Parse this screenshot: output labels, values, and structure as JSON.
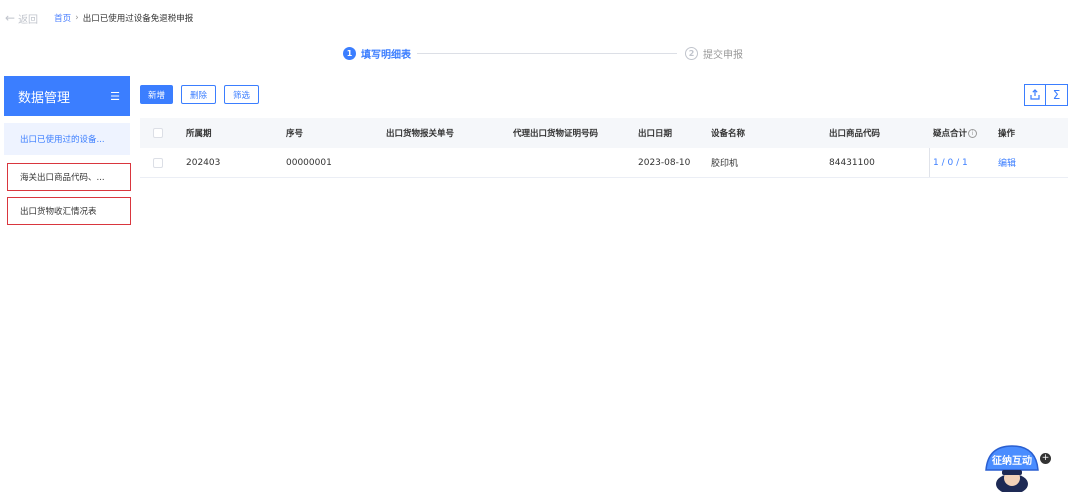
{
  "nav": {
    "back_label": "返回",
    "crumb_home": "首页",
    "crumb_sep": "›",
    "crumb_current": "出口已使用过设备免退税申报"
  },
  "steps": [
    {
      "num": "1",
      "label": "填写明细表",
      "active": true
    },
    {
      "num": "2",
      "label": "提交申报",
      "active": false
    }
  ],
  "sidebar": {
    "title": "数据管理",
    "toggle_icon": "menu-collapse-icon",
    "items": [
      {
        "label": "出口已使用过的设备..."
      },
      {
        "label": "海关出口商品代码、..."
      },
      {
        "label": "出口货物收汇情况表"
      }
    ]
  },
  "toolbar": {
    "add_label": "新增",
    "delete_label": "删除",
    "filter_label": "筛选",
    "export_icon": "export-icon",
    "sum_icon": "sigma-icon"
  },
  "table": {
    "columns": [
      "所属期",
      "序号",
      "出口货物报关单号",
      "代理出口货物证明号码",
      "出口日期",
      "设备名称",
      "出口商品代码",
      "疑点合计",
      "操作"
    ],
    "rows": [
      {
        "period": "202403",
        "seq": "00000001",
        "customs_no": "",
        "proxy_no": "",
        "export_date": "2023-08-10",
        "device_name": "胶印机",
        "goods_code": "84431100",
        "doubt_total": "1 / 0 / 1",
        "action": "编辑"
      }
    ]
  },
  "mascot": {
    "text": "征纳互动",
    "plus": "+"
  },
  "colors": {
    "accent": "#3b7eff",
    "alert_border": "#d9363e"
  }
}
